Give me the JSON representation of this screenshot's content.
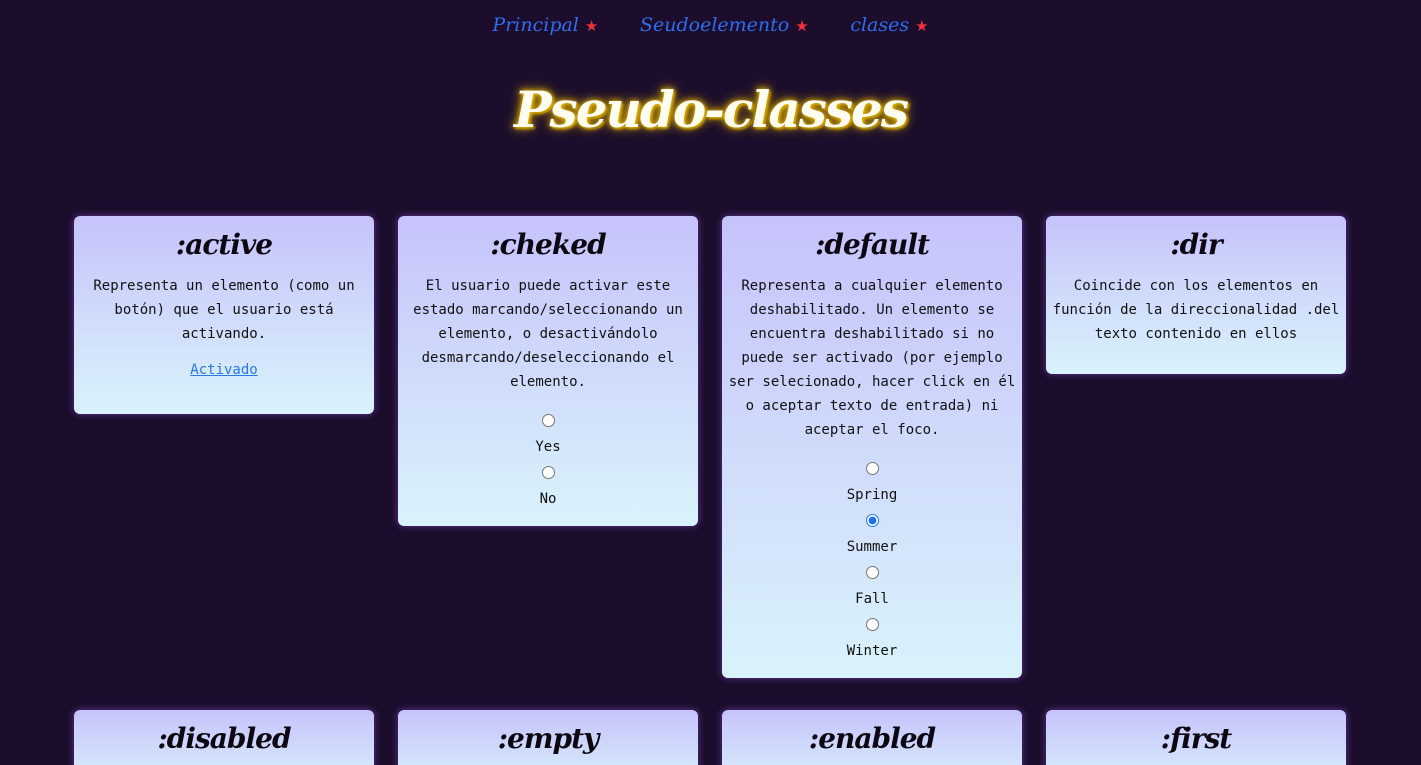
{
  "nav": {
    "items": [
      {
        "label": "Principal",
        "star": "★"
      },
      {
        "label": "Seudoelemento",
        "star": "★"
      },
      {
        "label": "clases",
        "star": "★"
      }
    ]
  },
  "header": {
    "title": "Pseudo-classes"
  },
  "cards": [
    {
      "title": ":active",
      "text": "Representa un elemento (como un botón) que el usuario está activando.",
      "link": "Activado"
    },
    {
      "title": ":cheked",
      "text": "El usuario puede activar este estado marcando/seleccionando un elemento, o desactivándolo desmarcando/deseleccionando el elemento.",
      "options": [
        "Yes",
        "No"
      ],
      "selected": null
    },
    {
      "title": ":default",
      "text": "Representa a cualquier elemento deshabilitado. Un elemento se encuentra deshabilitado si no puede ser activado (por ejemplo ser selecionado, hacer click en él o aceptar texto de entrada) ni aceptar el foco.",
      "options": [
        "Spring",
        "Summer",
        "Fall",
        "Winter"
      ],
      "selected": "Summer"
    },
    {
      "title": ":dir",
      "text": "Coincide con los elementos en función de la direccionalidad .del texto contenido en ellos"
    },
    {
      "title": ":disabled"
    },
    {
      "title": ":empty"
    },
    {
      "title": ":enabled"
    },
    {
      "title": ":first"
    }
  ],
  "colors": {
    "background": "#1b0d2b",
    "nav_link": "#2f6df0",
    "star": "#f0313b",
    "title_glow": "#f2c100",
    "card_top": "#c6c3fb",
    "card_bottom": "#d9f3fb",
    "link": "#2a78e0"
  }
}
